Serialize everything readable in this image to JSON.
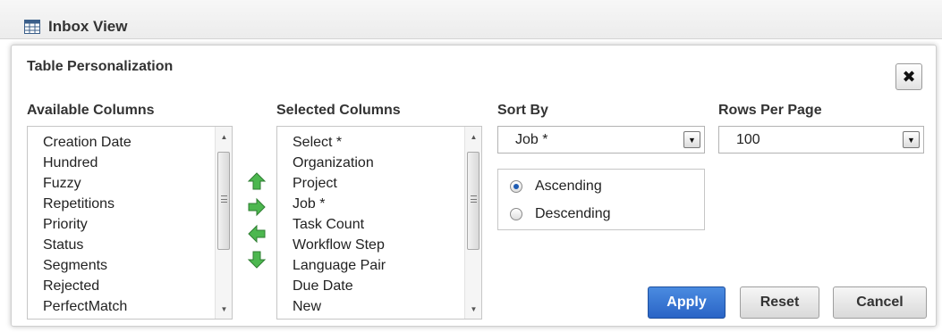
{
  "header": {
    "title": "Inbox View",
    "icon": "table-grid-icon"
  },
  "dialog": {
    "title": "Table Personalization",
    "close_label": "✖",
    "available_columns": {
      "label": "Available Columns",
      "items": [
        "Creation Date",
        "Hundred",
        "Fuzzy",
        "Repetitions",
        "Priority",
        "Status",
        "Segments",
        "Rejected",
        "PerfectMatch"
      ]
    },
    "selected_columns": {
      "label": "Selected Columns",
      "items": [
        "Select *",
        "Organization",
        "Project",
        "Job *",
        "Task Count",
        "Workflow Step",
        "Language Pair",
        "Due Date",
        "New"
      ]
    },
    "move_controls": [
      "arrow-up-icon",
      "arrow-right-icon",
      "arrow-left-icon",
      "arrow-down-icon"
    ],
    "sort_by": {
      "label": "Sort By",
      "value": "Job *",
      "order_options": [
        "Ascending",
        "Descending"
      ],
      "selected_order": "Ascending"
    },
    "rows_per_page": {
      "label": "Rows Per Page",
      "value": "100"
    },
    "buttons": {
      "apply": "Apply",
      "reset": "Reset",
      "cancel": "Cancel"
    }
  },
  "colors": {
    "accent": "#2a64c6",
    "arrow_green": "#3aa845",
    "header_bg": "#ececec"
  }
}
